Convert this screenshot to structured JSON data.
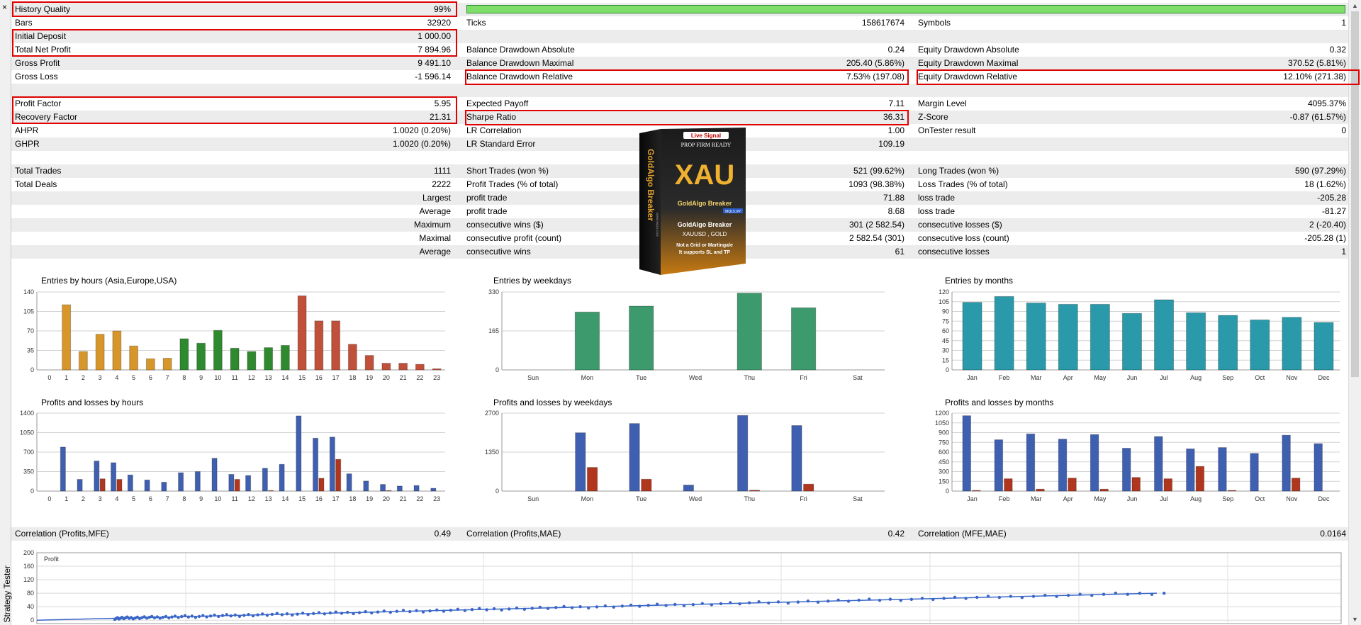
{
  "window": {
    "close_glyph": "×",
    "panel_label": "Strategy Tester"
  },
  "stats": {
    "history_quality": {
      "label": "History Quality",
      "value": "99%"
    },
    "bars": {
      "label": "Bars",
      "value": "32920"
    },
    "ticks": {
      "label": "Ticks",
      "value": "158617674"
    },
    "symbols": {
      "label": "Symbols",
      "value": "1"
    },
    "initial_deposit": {
      "label": "Initial Deposit",
      "value": "1 000.00"
    },
    "total_net_profit": {
      "label": "Total Net Profit",
      "value": "7 894.96"
    },
    "balance_dd_abs": {
      "label": "Balance Drawdown Absolute",
      "value": "0.24"
    },
    "equity_dd_abs": {
      "label": "Equity Drawdown Absolute",
      "value": "0.32"
    },
    "gross_profit": {
      "label": "Gross Profit",
      "value": "9 491.10"
    },
    "balance_dd_max": {
      "label": "Balance Drawdown Maximal",
      "value": "205.40 (5.86%)"
    },
    "equity_dd_max": {
      "label": "Equity Drawdown Maximal",
      "value": "370.52 (5.81%)"
    },
    "gross_loss": {
      "label": "Gross Loss",
      "value": "-1 596.14"
    },
    "balance_dd_rel": {
      "label": "Balance Drawdown Relative",
      "value": "7.53% (197.08)"
    },
    "equity_dd_rel": {
      "label": "Equity Drawdown Relative",
      "value": "12.10% (271.38)"
    },
    "profit_factor": {
      "label": "Profit Factor",
      "value": "5.95"
    },
    "expected_payoff": {
      "label": "Expected Payoff",
      "value": "7.11"
    },
    "margin_level": {
      "label": "Margin Level",
      "value": "4095.37%"
    },
    "recovery_factor": {
      "label": "Recovery Factor",
      "value": "21.31"
    },
    "sharpe_ratio": {
      "label": "Sharpe Ratio",
      "value": "36.31"
    },
    "z_score": {
      "label": "Z-Score",
      "value": "-0.87 (61.57%)"
    },
    "ahpr": {
      "label": "AHPR",
      "value": "1.0020 (0.20%)"
    },
    "lr_correlation": {
      "label": "LR Correlation",
      "value": "1.00"
    },
    "ontester": {
      "label": "OnTester result",
      "value": "0"
    },
    "ghpr": {
      "label": "GHPR",
      "value": "1.0020 (0.20%)"
    },
    "lr_std_error": {
      "label": "LR Standard Error",
      "value": "109.19"
    },
    "total_trades": {
      "label": "Total Trades",
      "value": "1111"
    },
    "short_trades": {
      "label": "Short Trades (won %)",
      "value": "521 (99.62%)"
    },
    "long_trades": {
      "label": "Long Trades (won %)",
      "value": "590 (97.29%)"
    },
    "total_deals": {
      "label": "Total Deals",
      "value": "2222"
    },
    "profit_trades": {
      "label": "Profit Trades (% of total)",
      "value": "1093 (98.38%)"
    },
    "loss_trades": {
      "label": "Loss Trades (% of total)",
      "value": "18 (1.62%)"
    },
    "largest": {
      "label": "Largest",
      "profit_label": "profit trade",
      "profit": "71.88",
      "loss_label": "loss trade",
      "loss": "-205.28"
    },
    "average": {
      "label": "Average",
      "profit_label": "profit trade",
      "profit": "8.68",
      "loss_label": "loss trade",
      "loss": "-81.27"
    },
    "maximum": {
      "label": "Maximum",
      "profit_label": "consecutive wins ($)",
      "profit": "301 (2 582.54)",
      "loss_label": "consecutive losses ($)",
      "loss": "2 (-20.40)"
    },
    "maximal": {
      "label": "Maximal",
      "profit_label": "consecutive profit (count)",
      "profit": "2 582.54 (301)",
      "loss_label": "consecutive loss (count)",
      "loss": "-205.28 (1)"
    },
    "average2": {
      "label": "Average",
      "profit_label": "consecutive wins",
      "profit": "61",
      "loss_label": "consecutive losses",
      "loss": "1"
    },
    "corr_mfe": {
      "label": "Correlation (Profits,MFE)",
      "value": "0.49"
    },
    "corr_mae": {
      "label": "Correlation (Profits,MAE)",
      "value": "0.42"
    },
    "corr_mfe_mae": {
      "label": "Correlation (MFE,MAE)",
      "value": "0.0164"
    }
  },
  "ad": {
    "live_signal": "Live Signal",
    "prop": "PROP FIRM READY",
    "xau": "XAU",
    "brand": "GoldAlgo Breaker",
    "badge": "MQL5.VP",
    "product": "GoldAlgo Breaker",
    "symbols": "XAUUSD , GOLD",
    "line1": "Not a Grid or Martingale",
    "line2": "It supports SL and TP",
    "side": "GoldAlgo Breaker",
    "url": "WWW.MQL5.COM"
  },
  "colors": {
    "asia": "#d7962a",
    "europe": "#2f8a2f",
    "usa": "#c0503a",
    "weekday": "#3c9a6c",
    "month": "#2a9aaa",
    "profit": "#3f5fb0",
    "loss": "#b0361e",
    "scatter": "#3a66c8"
  },
  "chart_data": [
    {
      "id": "entries_hours",
      "type": "bar",
      "title": "Entries by hours (Asia,Europe,USA)",
      "categories": [
        "0",
        "1",
        "2",
        "3",
        "4",
        "5",
        "6",
        "7",
        "8",
        "9",
        "10",
        "11",
        "12",
        "13",
        "14",
        "15",
        "16",
        "17",
        "18",
        "19",
        "20",
        "21",
        "22",
        "23"
      ],
      "values": [
        0,
        117,
        33,
        64,
        70,
        43,
        20,
        21,
        56,
        48,
        71,
        39,
        33,
        40,
        44,
        133,
        88,
        88,
        46,
        26,
        12,
        12,
        10,
        2
      ],
      "yticks": [
        0,
        35,
        70,
        105,
        140
      ],
      "ylim": [
        0,
        140
      ]
    },
    {
      "id": "entries_weekdays",
      "type": "bar",
      "title": "Entries by weekdays",
      "categories": [
        "Sun",
        "Mon",
        "Tue",
        "Wed",
        "Thu",
        "Fri",
        "Sat"
      ],
      "values": [
        0,
        245,
        270,
        0,
        325,
        263,
        0
      ],
      "yticks": [
        0,
        165,
        330
      ],
      "ylim": [
        0,
        330
      ]
    },
    {
      "id": "entries_months",
      "type": "bar",
      "title": "Entries by months",
      "categories": [
        "Jan",
        "Feb",
        "Mar",
        "Apr",
        "May",
        "Jun",
        "Jul",
        "Aug",
        "Sep",
        "Oct",
        "Nov",
        "Dec"
      ],
      "values": [
        104,
        113,
        103,
        101,
        101,
        87,
        108,
        88,
        84,
        77,
        81,
        73
      ],
      "yticks": [
        0,
        15,
        30,
        45,
        60,
        75,
        90,
        105,
        120
      ],
      "ylim": [
        0,
        120
      ]
    },
    {
      "id": "pl_hours",
      "type": "bar",
      "title": "Profits and losses by hours",
      "categories": [
        "0",
        "1",
        "2",
        "3",
        "4",
        "5",
        "6",
        "7",
        "8",
        "9",
        "10",
        "11",
        "12",
        "13",
        "14",
        "15",
        "16",
        "17",
        "18",
        "19",
        "20",
        "21",
        "22",
        "23"
      ],
      "series": [
        {
          "values": [
            0,
            790,
            210,
            540,
            510,
            290,
            200,
            160,
            330,
            350,
            590,
            300,
            280,
            410,
            480,
            1350,
            950,
            970,
            310,
            180,
            120,
            90,
            100,
            50
          ]
        },
        {
          "values": [
            0,
            0,
            0,
            220,
            210,
            0,
            0,
            0,
            0,
            0,
            0,
            210,
            0,
            10,
            0,
            0,
            230,
            570,
            0,
            0,
            10,
            0,
            0,
            0
          ]
        }
      ],
      "yticks": [
        0,
        350,
        700,
        1050,
        1400
      ],
      "ylim": [
        0,
        1400
      ]
    },
    {
      "id": "pl_weekdays",
      "type": "bar",
      "title": "Profits and losses by weekdays",
      "categories": [
        "Sun",
        "Mon",
        "Tue",
        "Wed",
        "Thu",
        "Fri",
        "Sat"
      ],
      "series": [
        {
          "values": [
            0,
            2020,
            2340,
            210,
            2620,
            2270,
            0
          ]
        },
        {
          "values": [
            0,
            820,
            410,
            0,
            30,
            240,
            0
          ]
        }
      ],
      "yticks": [
        0,
        1350,
        2700
      ],
      "ylim": [
        0,
        2700
      ]
    },
    {
      "id": "pl_months",
      "type": "bar",
      "title": "Profits and losses by months",
      "categories": [
        "Jan",
        "Feb",
        "Mar",
        "Apr",
        "May",
        "Jun",
        "Jul",
        "Aug",
        "Sep",
        "Oct",
        "Nov",
        "Dec"
      ],
      "series": [
        {
          "values": [
            1160,
            790,
            880,
            800,
            870,
            660,
            840,
            650,
            670,
            580,
            860,
            730
          ]
        },
        {
          "values": [
            10,
            190,
            30,
            200,
            30,
            210,
            190,
            380,
            10,
            0,
            200,
            0
          ]
        }
      ],
      "yticks": [
        0,
        150,
        300,
        450,
        600,
        750,
        900,
        1050,
        1200
      ],
      "ylim": [
        0,
        1200
      ]
    },
    {
      "id": "mfe_scatter",
      "type": "scatter",
      "title": "Profit",
      "yticks": [
        0,
        40,
        80,
        120,
        160,
        200
      ],
      "ylim": [
        -10,
        200
      ],
      "trend": [
        [
          0,
          0
        ],
        [
          1580,
          80
        ]
      ]
    }
  ]
}
